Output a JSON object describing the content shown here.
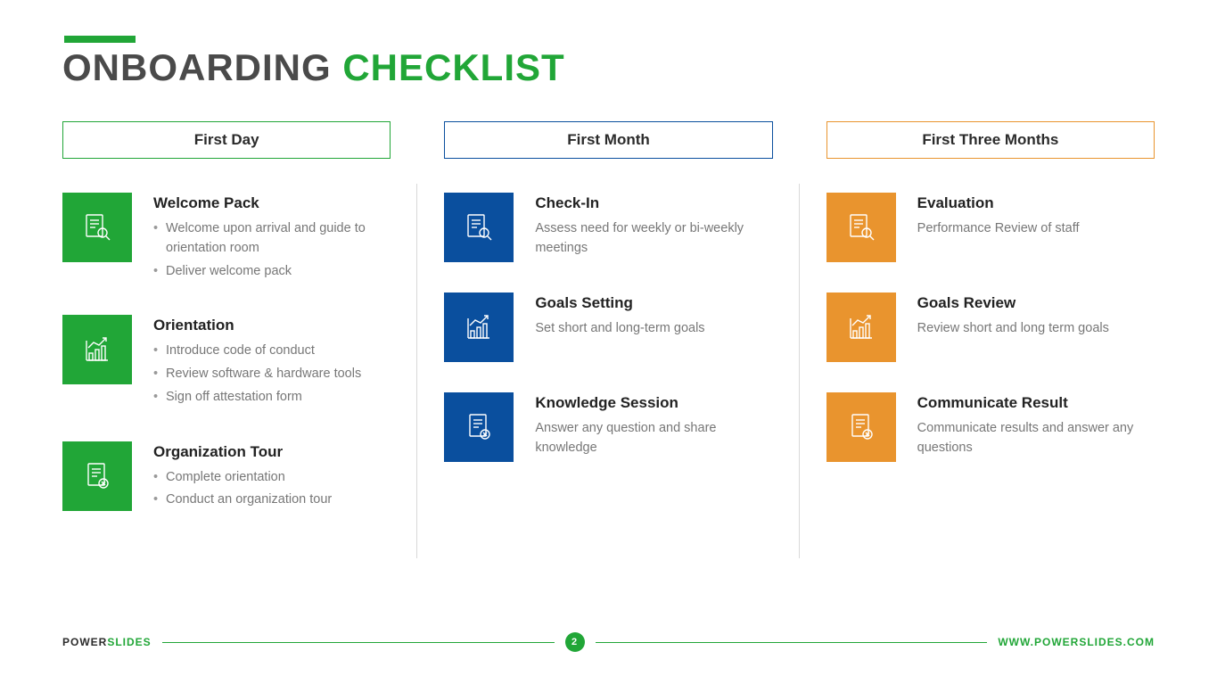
{
  "title": {
    "part1": "ONBOARDING ",
    "part2": "CHECKLIST"
  },
  "columns": [
    {
      "header": "First Day",
      "color": "green",
      "items": [
        {
          "icon": "doc-search",
          "title": "Welcome Pack",
          "bullets": [
            "Welcome upon arrival and guide to orientation room",
            "Deliver welcome pack"
          ]
        },
        {
          "icon": "chart-up",
          "title": "Orientation",
          "bullets": [
            "Introduce code of conduct",
            "Review software & hardware tools",
            "Sign off attestation form"
          ]
        },
        {
          "icon": "doc-x",
          "title": "Organization Tour",
          "bullets": [
            "Complete orientation",
            "Conduct an organization tour"
          ]
        }
      ]
    },
    {
      "header": "First Month",
      "color": "blue",
      "items": [
        {
          "icon": "doc-search",
          "title": "Check-In",
          "desc": "Assess need for weekly or bi-weekly meetings"
        },
        {
          "icon": "chart-up",
          "title": "Goals Setting",
          "desc": "Set short and long-term goals"
        },
        {
          "icon": "doc-x",
          "title": "Knowledge Session",
          "desc": "Answer any question and share knowledge"
        }
      ]
    },
    {
      "header": "First Three Months",
      "color": "orange",
      "items": [
        {
          "icon": "doc-search",
          "title": "Evaluation",
          "desc": "Performance Review of staff"
        },
        {
          "icon": "chart-up",
          "title": "Goals Review",
          "desc": "Review short and long term goals"
        },
        {
          "icon": "doc-x",
          "title": "Communicate Result",
          "desc": "Communicate results and answer any questions"
        }
      ]
    }
  ],
  "footer": {
    "brand1": "POWER",
    "brand2": "SLIDES",
    "page": "2",
    "url": "WWW.POWERSLIDES.COM"
  }
}
